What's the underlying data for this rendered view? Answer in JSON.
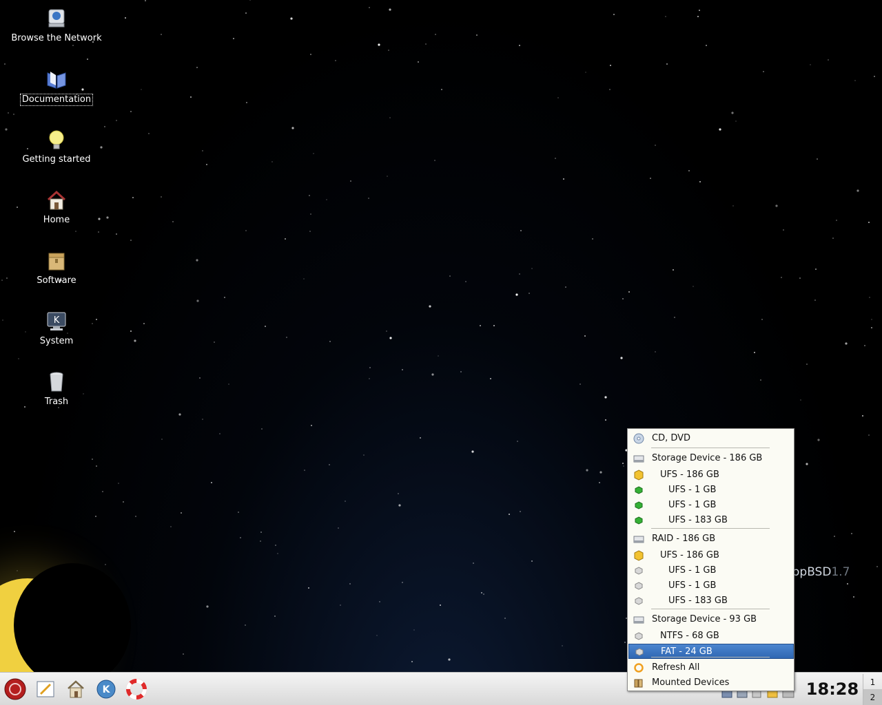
{
  "desktop": {
    "icons": [
      {
        "label": "Browse the Network",
        "icon": "network-icon"
      },
      {
        "label": "Documentation",
        "icon": "book-icon"
      },
      {
        "label": "Getting started",
        "icon": "lightbulb-icon"
      },
      {
        "label": "Home",
        "icon": "home-icon"
      },
      {
        "label": "Software",
        "icon": "package-icon"
      },
      {
        "label": "System",
        "icon": "system-monitor-icon"
      },
      {
        "label": "Trash",
        "icon": "trash-icon"
      }
    ],
    "brand": {
      "name": "opBSD",
      "version": "1.7"
    }
  },
  "menu": {
    "items": [
      {
        "label": "CD, DVD",
        "icon": "cd-dvd-icon"
      },
      {
        "label": "Storage Device - 186 GB",
        "icon": "hard-disk-icon"
      },
      {
        "label": "UFS - 186 GB",
        "icon": "yellow-partition-icon"
      },
      {
        "label": "UFS - 1 GB",
        "icon": "green-partition-icon"
      },
      {
        "label": "UFS - 1 GB",
        "icon": "green-partition-icon"
      },
      {
        "label": "UFS - 183 GB",
        "icon": "green-partition-icon"
      },
      {
        "label": "RAID - 186 GB",
        "icon": "hard-disk-icon"
      },
      {
        "label": "UFS - 186 GB",
        "icon": "yellow-partition-icon"
      },
      {
        "label": "UFS - 1 GB",
        "icon": "gray-partition-icon"
      },
      {
        "label": "UFS - 1 GB",
        "icon": "gray-partition-icon"
      },
      {
        "label": "UFS - 183 GB",
        "icon": "gray-partition-icon"
      },
      {
        "label": "Storage Device - 93 GB",
        "icon": "hard-disk-icon"
      },
      {
        "label": "NTFS - 68 GB",
        "icon": "gray-partition-icon"
      },
      {
        "label": "FAT - 24 GB",
        "icon": "gray-partition-icon"
      },
      {
        "label": "Refresh All",
        "icon": "refresh-icon"
      },
      {
        "label": "Mounted Devices",
        "icon": "mounted-devices-icon"
      }
    ],
    "highlighted_index": 13
  },
  "taskbar": {
    "clock": "18:28",
    "pager": [
      "1",
      "2"
    ],
    "active_desktop": "2"
  },
  "colors": {
    "highlight": "#3a73c0",
    "menu_bg": "#fbfbf4",
    "moon": "#f0d040"
  }
}
